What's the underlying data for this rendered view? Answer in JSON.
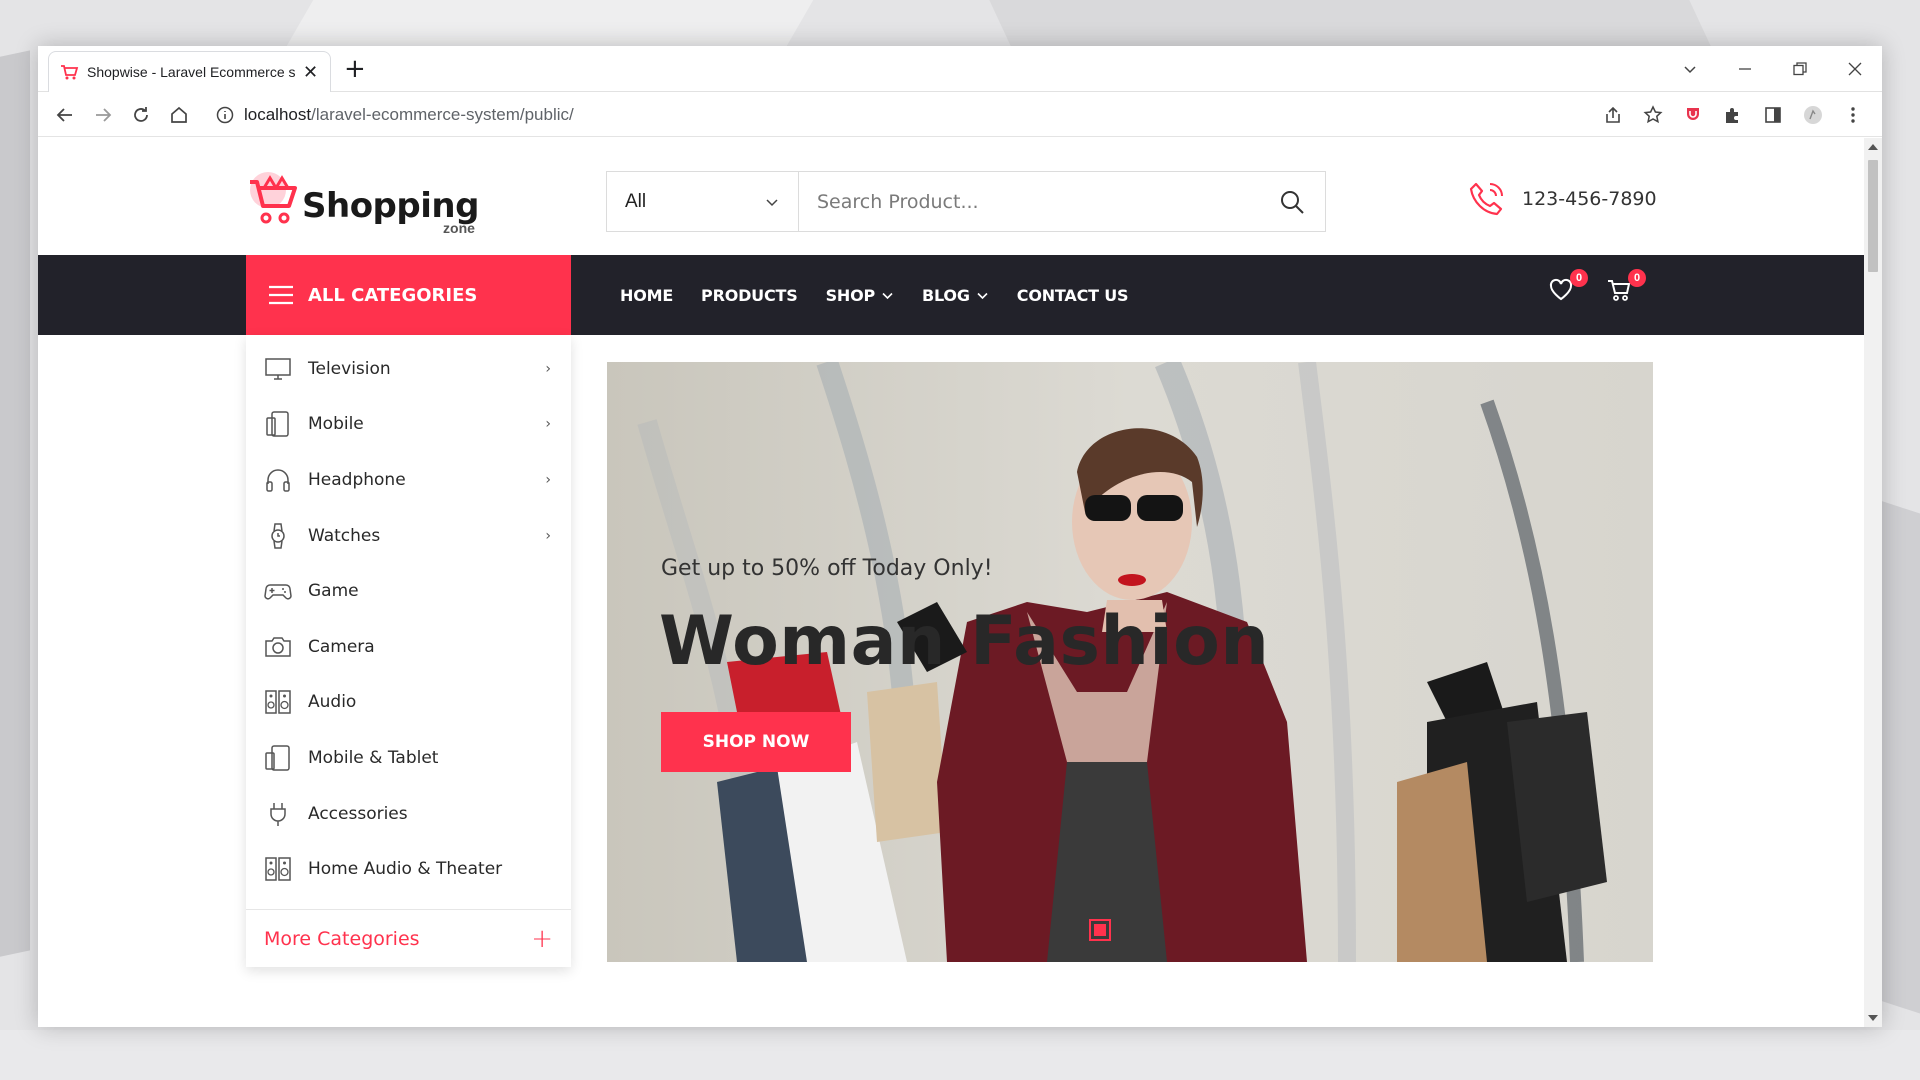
{
  "browser": {
    "tab_title": "Shopwise - Laravel Ecommerce s",
    "tab_close": "✕",
    "new_tab": "+",
    "url_host": "localhost",
    "url_path": "/laravel-ecommerce-system/public/"
  },
  "site": {
    "logo_word": "Shopping",
    "logo_sub": "zone",
    "search_category": "All",
    "search_placeholder": "Search Product...",
    "phone": "123-456-7890",
    "accent_color": "#ff324d",
    "nav_dark_color": "#22222a"
  },
  "nav": {
    "all_categories": "ALL CATEGORIES",
    "items": [
      {
        "label": "HOME"
      },
      {
        "label": "PRODUCTS"
      },
      {
        "label": "SHOP"
      },
      {
        "label": "BLOG"
      },
      {
        "label": "CONTACT US"
      }
    ],
    "wishlist_count": "0",
    "cart_count": "0"
  },
  "categories": {
    "items": [
      {
        "label": "Television",
        "icon": "television-icon"
      },
      {
        "label": "Mobile",
        "icon": "mobile-icon"
      },
      {
        "label": "Headphone",
        "icon": "headphone-icon"
      },
      {
        "label": "Watches",
        "icon": "watch-icon"
      },
      {
        "label": "Game",
        "icon": "gamepad-icon"
      },
      {
        "label": "Camera",
        "icon": "camera-icon"
      },
      {
        "label": "Audio",
        "icon": "speaker-icon"
      },
      {
        "label": "Mobile & Tablet",
        "icon": "tablet-icon"
      },
      {
        "label": "Accessories",
        "icon": "plug-icon"
      },
      {
        "label": "Home Audio & Theater",
        "icon": "speaker-icon"
      }
    ],
    "more_label": "More Categories",
    "more_icon": "+"
  },
  "hero": {
    "subtitle": "Get up to 50% off Today Only!",
    "title": "Woman Fashion",
    "button": "SHOP NOW"
  }
}
